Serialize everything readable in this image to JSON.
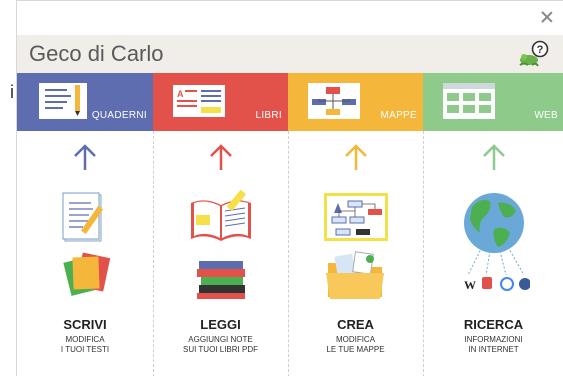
{
  "left_edge_char": "i",
  "window": {
    "title": "Geco di Carlo",
    "close_icon": "close-icon",
    "help_icon": "gecko-help-icon"
  },
  "colors": {
    "quaderni": "#5e6db0",
    "libri": "#e2524a",
    "mappe": "#f5b73b",
    "web": "#8ecb8a",
    "header_bg": "#f1eeea"
  },
  "columns": [
    {
      "band_label": "QUADERNI",
      "band_icon": "notebook-icon",
      "arrow_icon": "arrow-up-icon",
      "illustration": "write-notebooks-illustration",
      "title": "SCRIVI",
      "sub1": "MODIFICA",
      "sub2": "I TUOI TESTI"
    },
    {
      "band_label": "LIBRI",
      "band_icon": "book-icon",
      "arrow_icon": "arrow-up-icon",
      "illustration": "read-books-illustration",
      "title": "LEGGI",
      "sub1": "AGGIUNGI NOTE",
      "sub2": "SUI TUOI LIBRI PDF"
    },
    {
      "band_label": "MAPPE",
      "band_icon": "map-icon",
      "arrow_icon": "arrow-up-icon",
      "illustration": "create-maps-illustration",
      "title": "CREA",
      "sub1": "MODIFICA",
      "sub2": "LE TUE MAPPE"
    },
    {
      "band_label": "WEB",
      "band_icon": "web-icon",
      "arrow_icon": "arrow-up-icon",
      "illustration": "globe-search-illustration",
      "title": "RICERCA",
      "sub1": "INFORMAZIONI",
      "sub2": "IN INTERNET"
    }
  ]
}
